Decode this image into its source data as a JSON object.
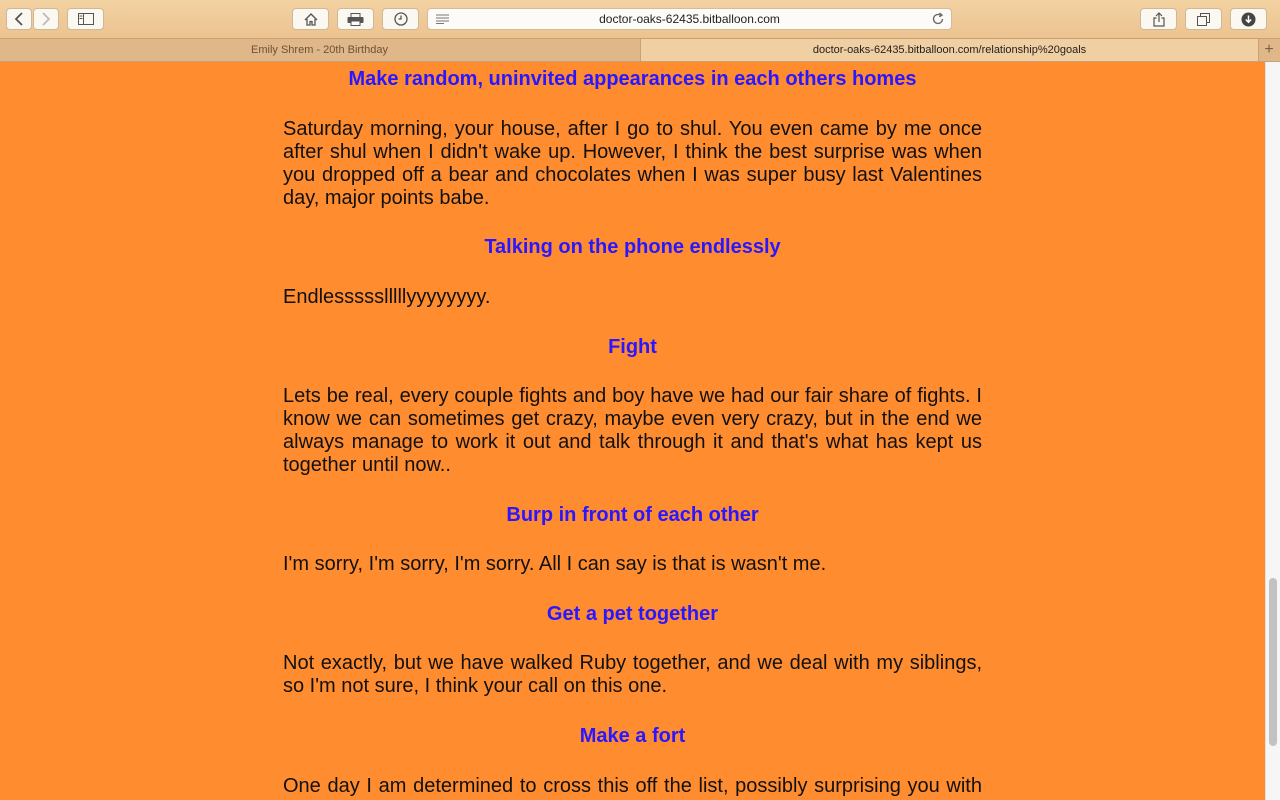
{
  "browser": {
    "url": "doctor-oaks-62435.bitballoon.com",
    "tabs": [
      {
        "label": "Emily Shrem - 20th Birthday"
      },
      {
        "label": "doctor-oaks-62435.bitballoon.com/relationship%20goals"
      }
    ],
    "icons": [
      "back-icon",
      "forward-icon",
      "sidebar-icon",
      "home-icon",
      "print-icon",
      "history-icon",
      "reader-icon",
      "reload-icon",
      "share-icon",
      "tabs-icon",
      "downloads-icon",
      "new-tab-icon"
    ]
  },
  "page": {
    "sections": [
      {
        "heading": "Make random, uninvited appearances in each others homes",
        "text": "Saturday morning, your house, after I go to shul. You even came by me once after shul when I didn't wake up. However, I think the best surprise was when you dropped off a bear and chocolates when I was super busy last Valentines day, major points babe."
      },
      {
        "heading": "Talking on the phone endlessly",
        "text": "Endlessssslllllyyyyyyyy."
      },
      {
        "heading": "Fight",
        "text": "Lets be real, every couple fights and boy have we had our fair share of fights. I know we can sometimes get crazy, maybe even very crazy, but in the end we always manage to work it out and talk through it and that's what has kept us together until now.."
      },
      {
        "heading": "Burp in front of each other",
        "text": "I'm sorry, I'm sorry, I'm sorry. All I can say is that is wasn't me."
      },
      {
        "heading": "Get a pet together",
        "text": "Not exactly, but we have walked Ruby together, and we deal with my siblings, so I'm not sure, I think your call on this one."
      },
      {
        "heading": "Make a fort",
        "text": "One day I am determined to cross this off the list, possibly surprising you with a"
      }
    ]
  },
  "colors": {
    "page_background": "#ff8c2f",
    "heading": "#2a17ff",
    "body_text": "#111111"
  }
}
